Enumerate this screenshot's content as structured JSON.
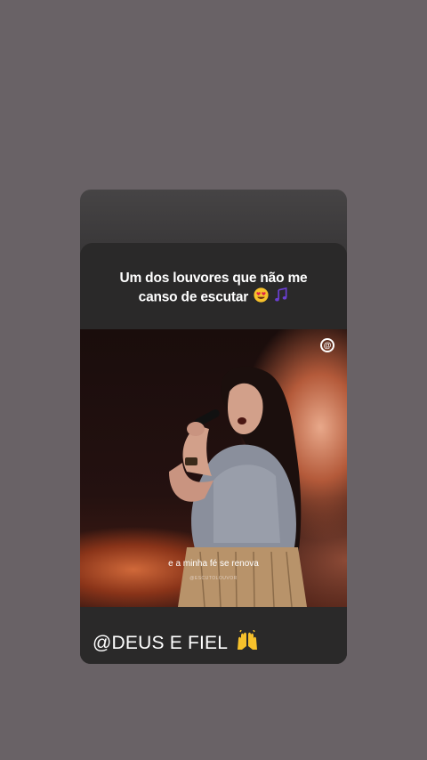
{
  "story": {
    "caption_line1": "Um dos louvores que não me",
    "caption_line2": "canso de escutar",
    "caption_emoji": "heart-eyes-emoji",
    "music_note": "♪",
    "lyric": "e a minha fé se renova",
    "video_handle": "@ESCUTOLOUVOR",
    "watermark_icon": "app-logo-icon",
    "mention_text": "@DEUS E FIEL",
    "mention_emoji": "raised-hands-emoji"
  },
  "colors": {
    "background": "#696266",
    "card": "#2a2929",
    "emoji_yellow": "#f7c12b",
    "heart_red": "#e0204a",
    "note_purple": "#6a3fd0"
  }
}
